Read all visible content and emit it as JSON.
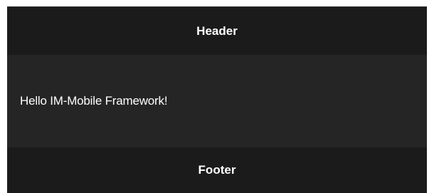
{
  "header": {
    "title": "Header"
  },
  "content": {
    "text": "Hello IM-Mobile Framework!"
  },
  "footer": {
    "title": "Footer"
  },
  "colors": {
    "bar_background": "#1b1b1b",
    "content_background": "#252525",
    "text": "#ffffff"
  }
}
